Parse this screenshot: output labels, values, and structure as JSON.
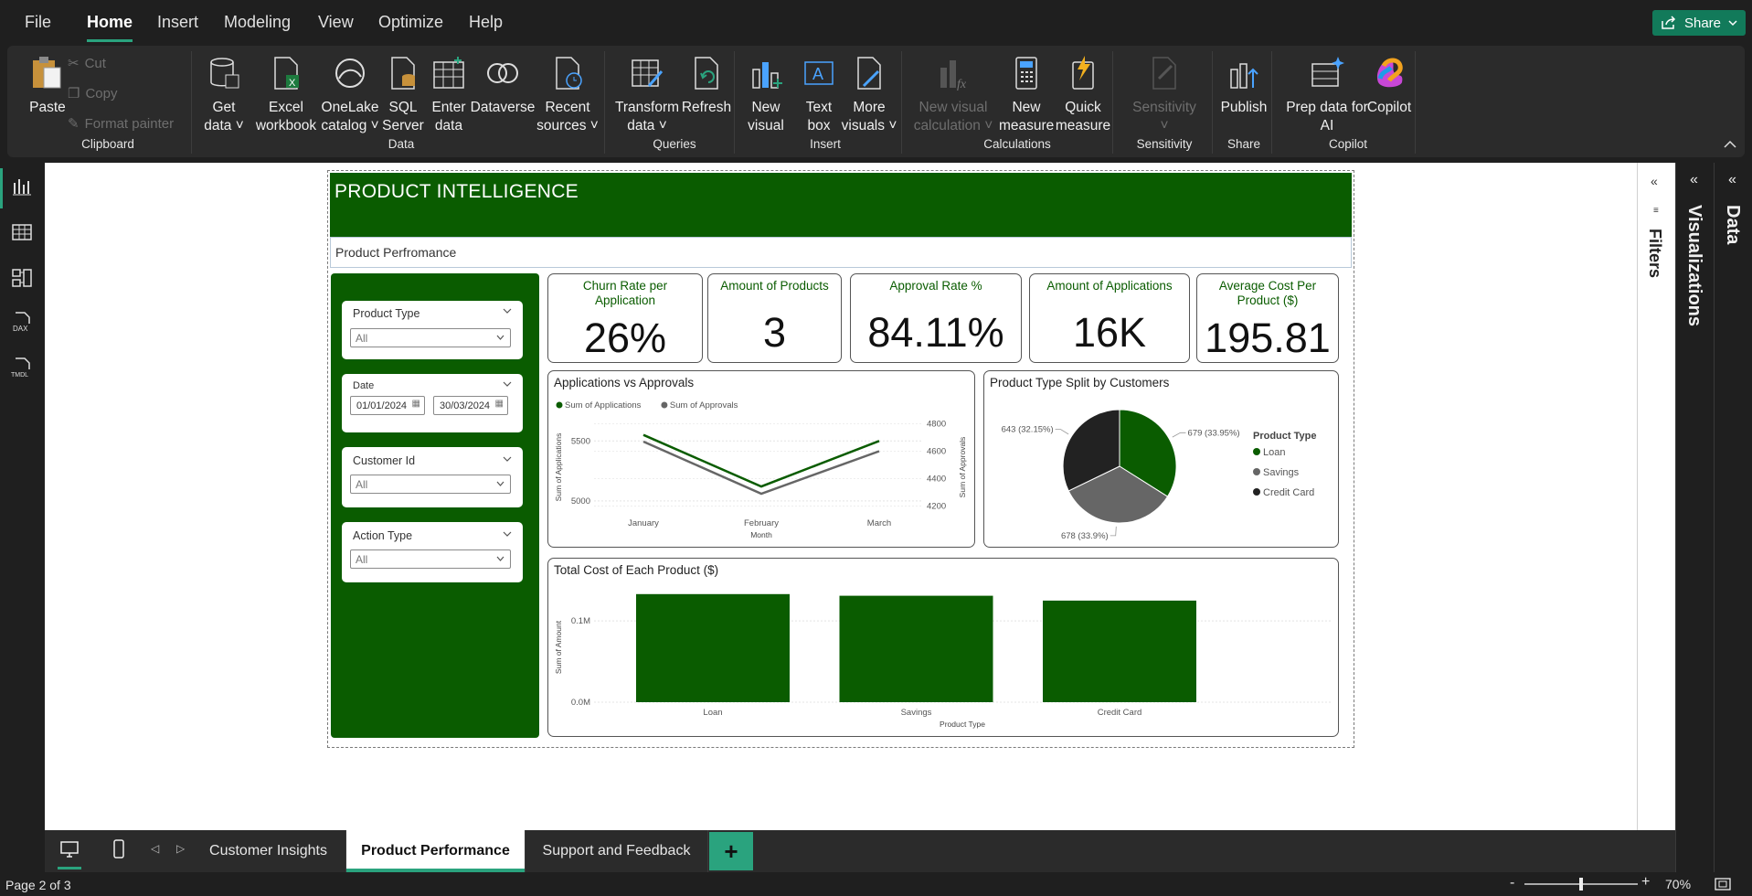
{
  "menu": {
    "items": [
      "File",
      "Home",
      "Insert",
      "Modeling",
      "View",
      "Optimize",
      "Help"
    ],
    "active": "Home",
    "share_label": "Share"
  },
  "ribbon": {
    "clipboard": {
      "paste": "Paste",
      "cut": "Cut",
      "copy": "Copy",
      "format_painter": "Format painter",
      "group": "Clipboard"
    },
    "data": {
      "get_data": [
        "Get",
        "data"
      ],
      "excel": [
        "Excel",
        "workbook"
      ],
      "onelake": [
        "OneLake",
        "catalog"
      ],
      "sql": [
        "SQL",
        "Server"
      ],
      "enter": [
        "Enter",
        "data"
      ],
      "dataverse": [
        "Dataverse"
      ],
      "recent": [
        "Recent",
        "sources"
      ],
      "group": "Data"
    },
    "queries": {
      "transform": [
        "Transform",
        "data"
      ],
      "refresh": [
        "Refresh"
      ],
      "group": "Queries"
    },
    "insert": {
      "new_visual": [
        "New",
        "visual"
      ],
      "text_box": [
        "Text",
        "box"
      ],
      "more_visuals": [
        "More",
        "visuals"
      ],
      "group": "Insert"
    },
    "calculations": {
      "new_visual_calc": [
        "New visual",
        "calculation"
      ],
      "new_measure": [
        "New",
        "measure"
      ],
      "quick_measure": [
        "Quick",
        "measure"
      ],
      "group": "Calculations"
    },
    "sensitivity": {
      "label": "Sensitivity",
      "group": "Sensitivity"
    },
    "share": {
      "publish": "Publish",
      "group": "Share"
    },
    "copilot": {
      "prep": [
        "Prep data for",
        "AI"
      ],
      "copilot": "Copilot",
      "group": "Copilot"
    }
  },
  "panes": {
    "filters": "Filters",
    "visualizations": "Visualizations",
    "data": "Data"
  },
  "report": {
    "title": "PRODUCT INTELLIGENCE",
    "subtitle": "Product Perfromance",
    "slicers": {
      "product_type": {
        "title": "Product Type",
        "value": "All"
      },
      "date": {
        "title": "Date",
        "start": "01/01/2024",
        "end": "30/03/2024"
      },
      "customer_id": {
        "title": "Customer Id",
        "value": "All"
      },
      "action_type": {
        "title": "Action Type",
        "value": "All"
      }
    },
    "cards": [
      {
        "title": "Churn Rate per Application",
        "value": "26%"
      },
      {
        "title": "Amount of Products",
        "value": "3"
      },
      {
        "title": "Approval Rate %",
        "value": "84.11%"
      },
      {
        "title": "Amount of Applications",
        "value": "16K"
      },
      {
        "title": "Average Cost Per Product ($)",
        "value": "195.81"
      }
    ],
    "line_title": "Applications vs Approvals",
    "pie_title": "Product Type Split by Customers",
    "bar_title": "Total Cost of Each Product ($)"
  },
  "chart_data": [
    {
      "type": "line",
      "title": "Applications vs Approvals",
      "categories": [
        "January",
        "February",
        "March"
      ],
      "xlabel": "Month",
      "ylabel": "Sum of Applications",
      "y2label": "Sum of Approvals",
      "ylim": [
        4900,
        5700
      ],
      "y2lim": [
        4150,
        4850
      ],
      "yticks": [
        "5500",
        "5000"
      ],
      "y2ticks": [
        "4800",
        "4600",
        "4400",
        "4200"
      ],
      "legend_position": "top-left",
      "series": [
        {
          "name": "Sum of Applications",
          "axis": "left",
          "color": "#0a5c00",
          "values": [
            5550,
            5120,
            5500
          ]
        },
        {
          "name": "Sum of Approvals",
          "axis": "right",
          "color": "#666666",
          "values": [
            4670,
            4290,
            4600
          ]
        }
      ]
    },
    {
      "type": "pie",
      "title": "Product Type Split by Customers",
      "legend_title": "Product Type",
      "legend_position": "right",
      "categories": [
        "Loan",
        "Savings",
        "Credit Card"
      ],
      "values": [
        679,
        678,
        643
      ],
      "labels": [
        "679 (33.95%)",
        "678 (33.9%)",
        "643 (32.15%)"
      ],
      "colors": [
        "#0a5c00",
        "#666666",
        "#222222"
      ]
    },
    {
      "type": "bar",
      "title": "Total Cost of Each Product ($)",
      "categories": [
        "Loan",
        "Savings",
        "Credit Card"
      ],
      "values": [
        0.133,
        0.131,
        0.125
      ],
      "xlabel": "Product Type",
      "ylabel": "Sum of Amount",
      "ylim": [
        0,
        0.135
      ],
      "yticks": [
        "0.1M",
        "0.0M"
      ],
      "color": "#0a5c00"
    }
  ],
  "tabs": {
    "pages": [
      "Customer Insights",
      "Product Performance",
      "Support and Feedback"
    ],
    "active": "Product Performance",
    "add": "+"
  },
  "status": {
    "page": "Page 2 of 3",
    "zoom": "70%",
    "zoom_level": 0.5
  }
}
